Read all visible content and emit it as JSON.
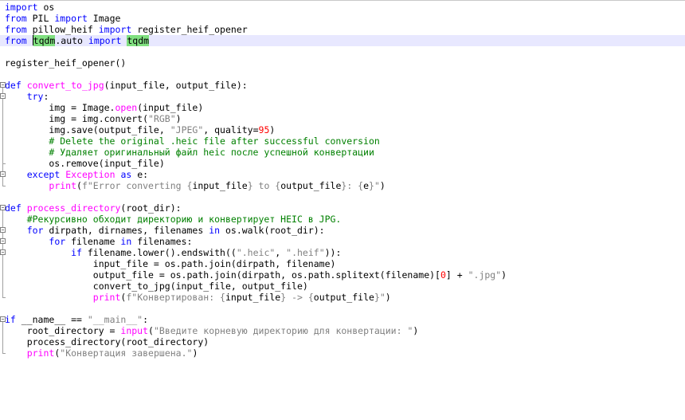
{
  "editor": {
    "lines": [
      {
        "segments": [
          {
            "t": "import",
            "c": "kw"
          },
          {
            "t": " os",
            "c": ""
          }
        ]
      },
      {
        "segments": [
          {
            "t": "from",
            "c": "kw"
          },
          {
            "t": " PIL ",
            "c": ""
          },
          {
            "t": "import",
            "c": "kw"
          },
          {
            "t": " Image",
            "c": ""
          }
        ]
      },
      {
        "segments": [
          {
            "t": "from",
            "c": "kw"
          },
          {
            "t": " pillow_heif ",
            "c": ""
          },
          {
            "t": "import",
            "c": "kw"
          },
          {
            "t": " register_heif_opener",
            "c": ""
          }
        ]
      },
      {
        "segments": [
          {
            "t": "from",
            "c": "kw"
          },
          {
            "t": " ",
            "c": ""
          },
          {
            "t": "|",
            "c": "caret"
          },
          {
            "t": "tqdm",
            "c": "hl"
          },
          {
            "t": ".auto ",
            "c": ""
          },
          {
            "t": "import",
            "c": "kw"
          },
          {
            "t": " ",
            "c": ""
          },
          {
            "t": "tqdm",
            "c": "hl"
          }
        ],
        "current": true
      },
      {
        "segments": []
      },
      {
        "segments": [
          {
            "t": "register_heif_opener()",
            "c": ""
          }
        ]
      },
      {
        "segments": []
      },
      {
        "segments": [
          {
            "t": "def",
            "c": "kw"
          },
          {
            "t": " ",
            "c": ""
          },
          {
            "t": "convert_to_jpg",
            "c": "fn"
          },
          {
            "t": "(input_file, output_file):",
            "c": ""
          }
        ]
      },
      {
        "segments": [
          {
            "t": "    ",
            "c": ""
          },
          {
            "t": "try",
            "c": "kw"
          },
          {
            "t": ":",
            "c": ""
          }
        ]
      },
      {
        "segments": [
          {
            "t": "        img = Image.",
            "c": ""
          },
          {
            "t": "open",
            "c": "fn"
          },
          {
            "t": "(input_file)",
            "c": ""
          }
        ]
      },
      {
        "segments": [
          {
            "t": "        img = img.convert(",
            "c": ""
          },
          {
            "t": "\"RGB\"",
            "c": "st"
          },
          {
            "t": ")",
            "c": ""
          }
        ]
      },
      {
        "segments": [
          {
            "t": "        img.save(output_file, ",
            "c": ""
          },
          {
            "t": "\"JPEG\"",
            "c": "st"
          },
          {
            "t": ", quality=",
            "c": ""
          },
          {
            "t": "95",
            "c": "num"
          },
          {
            "t": ")",
            "c": ""
          }
        ]
      },
      {
        "segments": [
          {
            "t": "        # Delete the original .heic file after successful conversion",
            "c": "cm"
          }
        ]
      },
      {
        "segments": [
          {
            "t": "        # Удаляет оригинальный файл heic после успешной конвертации",
            "c": "cm"
          }
        ]
      },
      {
        "segments": [
          {
            "t": "        os.remove(input_file)",
            "c": ""
          }
        ]
      },
      {
        "segments": [
          {
            "t": "    ",
            "c": ""
          },
          {
            "t": "except",
            "c": "kw"
          },
          {
            "t": " ",
            "c": ""
          },
          {
            "t": "Exception",
            "c": "fn"
          },
          {
            "t": " ",
            "c": ""
          },
          {
            "t": "as",
            "c": "kw"
          },
          {
            "t": " e:",
            "c": ""
          }
        ]
      },
      {
        "segments": [
          {
            "t": "        ",
            "c": ""
          },
          {
            "t": "print",
            "c": "fn"
          },
          {
            "t": "(",
            "c": ""
          },
          {
            "t": "f\"Error converting {",
            "c": "st"
          },
          {
            "t": "input_file",
            "c": ""
          },
          {
            "t": "} to {",
            "c": "st"
          },
          {
            "t": "output_file",
            "c": ""
          },
          {
            "t": "}: {",
            "c": "st"
          },
          {
            "t": "e",
            "c": ""
          },
          {
            "t": "}\"",
            "c": "st"
          },
          {
            "t": ")",
            "c": ""
          }
        ]
      },
      {
        "segments": []
      },
      {
        "segments": [
          {
            "t": "def",
            "c": "kw"
          },
          {
            "t": " ",
            "c": ""
          },
          {
            "t": "process_directory",
            "c": "fn"
          },
          {
            "t": "(root_dir):",
            "c": ""
          }
        ]
      },
      {
        "segments": [
          {
            "t": "    #Рекурсивно обходит директорию и конвертирует HEIC в JPG.",
            "c": "cm"
          }
        ]
      },
      {
        "segments": [
          {
            "t": "    ",
            "c": ""
          },
          {
            "t": "for",
            "c": "kw"
          },
          {
            "t": " dirpath, dirnames, filenames ",
            "c": ""
          },
          {
            "t": "in",
            "c": "kw"
          },
          {
            "t": " os.walk(root_dir):",
            "c": ""
          }
        ]
      },
      {
        "segments": [
          {
            "t": "        ",
            "c": ""
          },
          {
            "t": "for",
            "c": "kw"
          },
          {
            "t": " filename ",
            "c": ""
          },
          {
            "t": "in",
            "c": "kw"
          },
          {
            "t": " filenames:",
            "c": ""
          }
        ]
      },
      {
        "segments": [
          {
            "t": "            ",
            "c": ""
          },
          {
            "t": "if",
            "c": "kw"
          },
          {
            "t": " filename.lower().endswith((",
            "c": ""
          },
          {
            "t": "\".heic\"",
            "c": "st"
          },
          {
            "t": ", ",
            "c": ""
          },
          {
            "t": "\".heif\"",
            "c": "st"
          },
          {
            "t": ")):",
            "c": ""
          }
        ]
      },
      {
        "segments": [
          {
            "t": "                input_file = os.path.join(dirpath, filename)",
            "c": ""
          }
        ]
      },
      {
        "segments": [
          {
            "t": "                output_file = os.path.join(dirpath, os.path.splitext(filename)[",
            "c": ""
          },
          {
            "t": "0",
            "c": "num"
          },
          {
            "t": "] + ",
            "c": ""
          },
          {
            "t": "\".jpg\"",
            "c": "st"
          },
          {
            "t": ")",
            "c": ""
          }
        ]
      },
      {
        "segments": [
          {
            "t": "                convert_to_jpg(input_file, output_file)",
            "c": ""
          }
        ]
      },
      {
        "segments": [
          {
            "t": "                ",
            "c": ""
          },
          {
            "t": "print",
            "c": "fn"
          },
          {
            "t": "(",
            "c": ""
          },
          {
            "t": "f\"Конвертирован: {",
            "c": "st"
          },
          {
            "t": "input_file",
            "c": ""
          },
          {
            "t": "} -> {",
            "c": "st"
          },
          {
            "t": "output_file",
            "c": ""
          },
          {
            "t": "}\"",
            "c": "st"
          },
          {
            "t": ")",
            "c": ""
          }
        ]
      },
      {
        "segments": []
      },
      {
        "segments": [
          {
            "t": "if",
            "c": "kw"
          },
          {
            "t": " __name__ == ",
            "c": ""
          },
          {
            "t": "\"__main__\"",
            "c": "st"
          },
          {
            "t": ":",
            "c": ""
          }
        ]
      },
      {
        "segments": [
          {
            "t": "    root_directory = ",
            "c": ""
          },
          {
            "t": "input",
            "c": "fn"
          },
          {
            "t": "(",
            "c": ""
          },
          {
            "t": "\"Введите корневую директорию для конвертации: \"",
            "c": "st"
          },
          {
            "t": ")",
            "c": ""
          }
        ]
      },
      {
        "segments": [
          {
            "t": "    process_directory(root_directory)",
            "c": ""
          }
        ]
      },
      {
        "segments": [
          {
            "t": "    ",
            "c": ""
          },
          {
            "t": "print",
            "c": "fn"
          },
          {
            "t": "(",
            "c": ""
          },
          {
            "t": "\"Конвертация завершена.\"",
            "c": "st"
          },
          {
            "t": ")",
            "c": ""
          }
        ]
      }
    ],
    "fold_blocks": [
      {
        "start": 7,
        "end": 16
      },
      {
        "start": 8,
        "end": 14
      },
      {
        "start": 15,
        "end": 16
      },
      {
        "start": 18,
        "end": 26
      },
      {
        "start": 20,
        "end": 26
      },
      {
        "start": 21,
        "end": 26
      },
      {
        "start": 22,
        "end": 26
      },
      {
        "start": 28,
        "end": 31
      }
    ]
  }
}
